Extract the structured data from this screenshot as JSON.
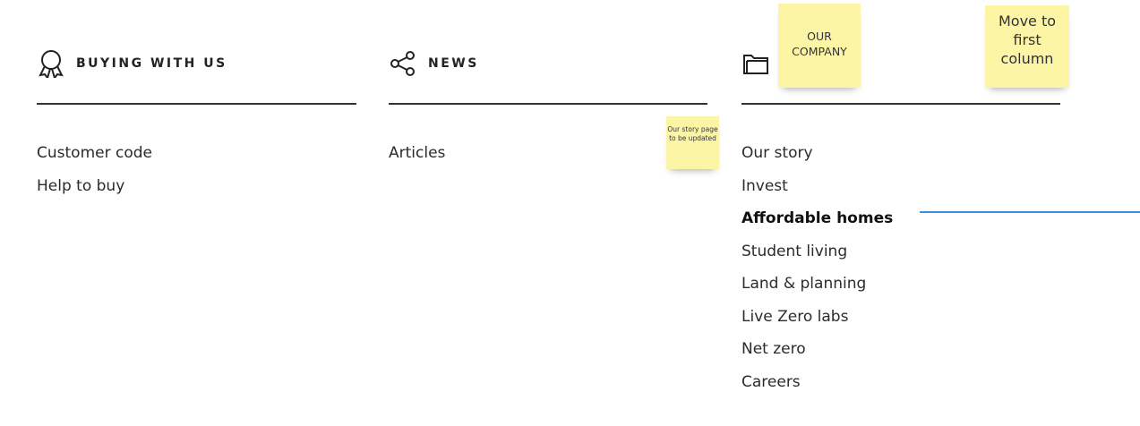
{
  "columns": {
    "buying": {
      "title": "BUYING WITH US",
      "icon": "award-ribbon-icon",
      "links": [
        "Customer code",
        "Help to buy"
      ]
    },
    "news": {
      "title": "NEWS",
      "icon": "share-icon",
      "links": [
        "Articles"
      ]
    },
    "company": {
      "icon": "folder-icon",
      "links": [
        "Our story",
        "Invest",
        "Affordable homes",
        "Student living",
        "Land & planning",
        "Live Zero labs",
        "Net zero",
        "Careers"
      ]
    }
  },
  "stickies": {
    "company_title": "OUR COMPANY",
    "move_note": "Move to first column",
    "story_note": "Our story page to be updated"
  },
  "colors": {
    "sticky": "#fdf5a6",
    "connector": "#3a8ee6",
    "rule": "#333333"
  }
}
